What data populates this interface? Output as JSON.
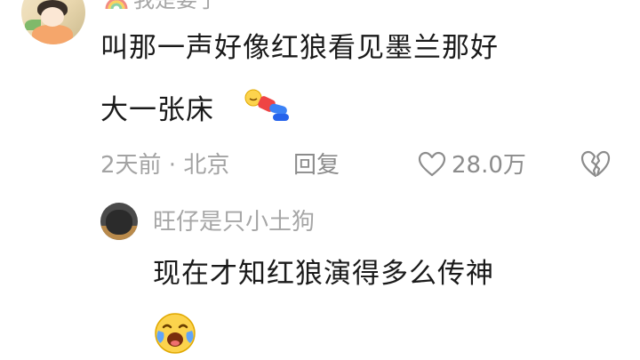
{
  "comment": {
    "username": "我是要了",
    "text_line1": "叫那一声好像红狼看见墨兰那好",
    "text_line2": "大一张床",
    "time_location": "2天前 · 北京",
    "reply_label": "回复",
    "like_count": "28.0万",
    "icons": {
      "avatar": "user-avatar",
      "badge": "rainbow-icon",
      "sticker": "falling-emoji-sticker",
      "like": "heart-outline-icon",
      "dislike": "broken-heart-icon"
    }
  },
  "reply": {
    "username": "旺仔是只小土狗",
    "text": "现在才知红狼演得多么传神",
    "icons": {
      "avatar": "dog-avatar",
      "emoji": "crying-laughing-emoji"
    }
  },
  "colors": {
    "text_primary": "#1a1a1a",
    "text_secondary": "#a3a3a3",
    "background": "#ffffff"
  }
}
